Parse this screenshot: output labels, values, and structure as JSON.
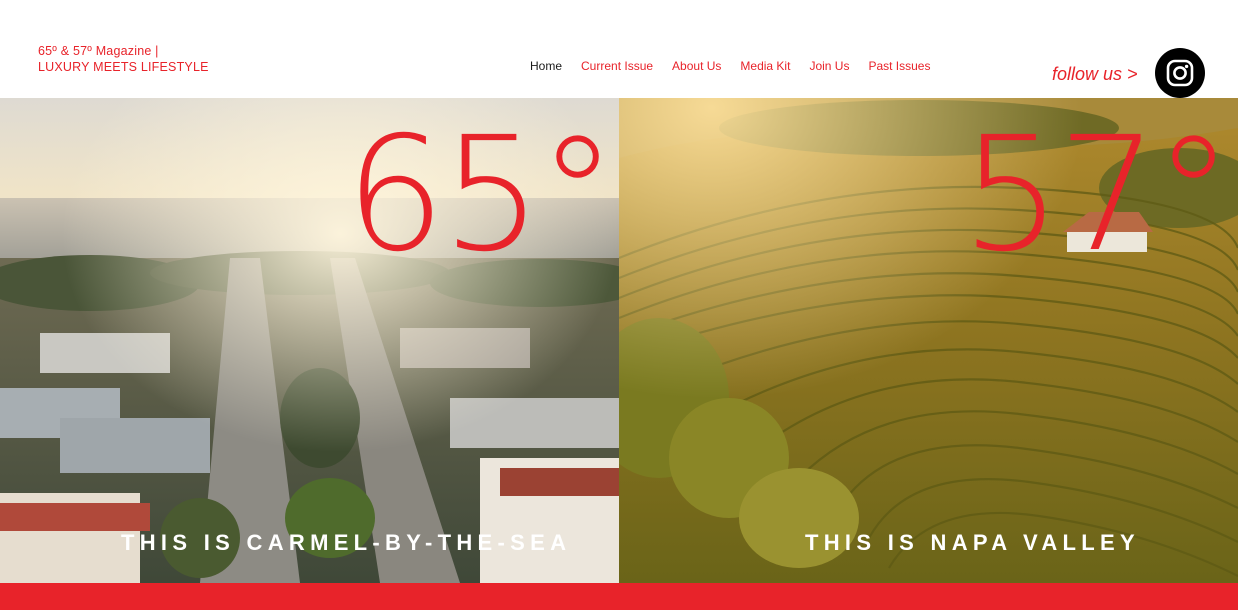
{
  "brand": {
    "line1": "65º & 57º Magazine |",
    "line2": "LUXURY MEETS LIFESTYLE"
  },
  "nav": {
    "items": [
      {
        "label": "Home",
        "active": true
      },
      {
        "label": "Current Issue",
        "active": false
      },
      {
        "label": "About Us",
        "active": false
      },
      {
        "label": "Media Kit",
        "active": false
      },
      {
        "label": "Join Us",
        "active": false
      },
      {
        "label": "Past Issues",
        "active": false
      }
    ]
  },
  "social": {
    "follow_label": "follow us >",
    "icon": "instagram-icon"
  },
  "panels": {
    "left": {
      "temperature": "65°",
      "caption": "THIS IS CARMEL-BY-THE-SEA"
    },
    "right": {
      "temperature": "57°",
      "caption": "THIS IS NAPA VALLEY"
    }
  },
  "colors": {
    "accent": "#e8232a",
    "nav_active": "#1a1a1a",
    "background": "#ffffff"
  }
}
